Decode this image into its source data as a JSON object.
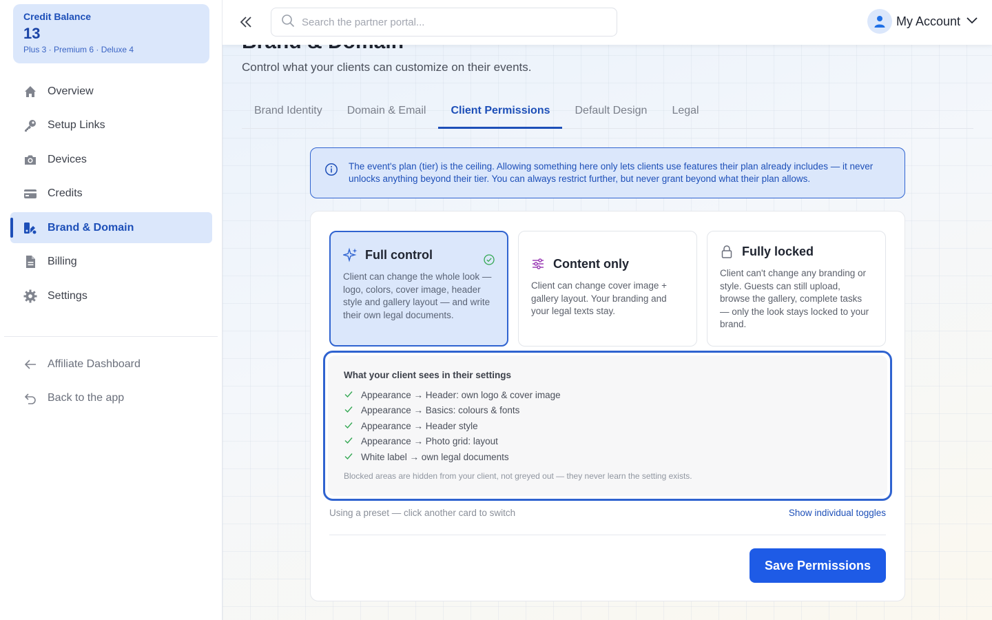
{
  "credit": {
    "label": "Credit Balance",
    "value": "13",
    "breakdown": "Plus 3 · Premium 6 · Deluxe 4"
  },
  "sidebar": {
    "items": [
      {
        "label": "Overview",
        "icon": "home-icon"
      },
      {
        "label": "Setup Links",
        "icon": "key-icon"
      },
      {
        "label": "Devices",
        "icon": "camera-icon"
      },
      {
        "label": "Credits",
        "icon": "credit-card-icon"
      },
      {
        "label": "Brand & Domain",
        "icon": "brand-icon",
        "active": true
      },
      {
        "label": "Billing",
        "icon": "document-icon"
      },
      {
        "label": "Settings",
        "icon": "gear-icon"
      }
    ],
    "footer_items": [
      {
        "label": "Affiliate Dashboard",
        "icon": "arrow-left-icon"
      },
      {
        "label": "Back to the app",
        "icon": "undo-icon"
      }
    ]
  },
  "topbar": {
    "search_placeholder": "Search the partner portal...",
    "account_label": "My Account"
  },
  "page": {
    "title": "Brand & Domain",
    "subtitle": "Control what your clients can customize on their events."
  },
  "tabs": [
    "Brand Identity",
    "Domain & Email",
    "Client Permissions",
    "Default Design",
    "Legal"
  ],
  "active_tab": "Client Permissions",
  "info_text": "The event's plan (tier) is the ceiling. Allowing something here only lets clients use features their plan already includes — it never unlocks anything beyond their tier. You can always restrict further, but never grant beyond what their plan allows.",
  "presets": [
    {
      "title": "Full control",
      "description": "Client can change the whole look — logo, colors, cover image, header style and gallery layout — and write their own legal documents.",
      "selected": true
    },
    {
      "title": "Content only",
      "description": "Client can change cover image + gallery layout. Your branding and your legal texts stay."
    },
    {
      "title": "Fully locked",
      "description": "Client can't change any branding or style. Guests can still upload, browse the gallery, complete tasks — only the look stays locked to your brand."
    }
  ],
  "preview": {
    "title": "What your client sees in their settings",
    "items": [
      "Appearance → Header: own logo & cover image",
      "Appearance → Basics: colours & fonts",
      "Appearance → Header style",
      "Appearance → Photo grid: layout",
      "White label → own legal documents"
    ],
    "note": "Blocked areas are hidden from your client, not greyed out — they never learn the setting exists."
  },
  "preset_hint": "Using a preset — click another card to switch",
  "toggles_link": "Show individual toggles",
  "save_label": "Save Permissions",
  "colors": {
    "accent": "#1d4fb8",
    "button": "#1e5be6",
    "selected_bg": "#dbe7fb"
  }
}
